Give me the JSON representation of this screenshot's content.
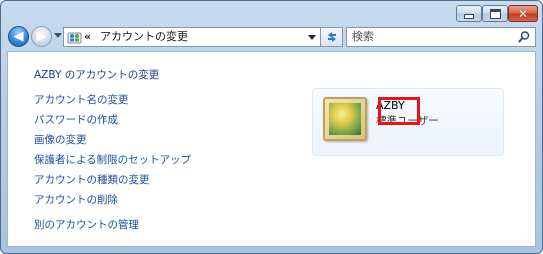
{
  "titlebar": {
    "minimize_icon": "minimize-icon",
    "maximize_icon": "maximize-icon",
    "close_icon": "close-icon",
    "close_glyph": "✕"
  },
  "navigation": {
    "back_icon": "back-arrow-icon",
    "forward_icon": "forward-arrow-icon",
    "back_glyph": "◀",
    "forward_glyph": "▶"
  },
  "address": {
    "chevron": "«",
    "path": "アカウントの変更"
  },
  "search": {
    "placeholder": "検索"
  },
  "tasks": {
    "title": "AZBY のアカウントの変更",
    "items": [
      "アカウント名の変更",
      "パスワードの作成",
      "画像の変更",
      "保護者による制限のセットアップ",
      "アカウントの種類の変更",
      "アカウントの削除"
    ],
    "manage_other": "別のアカウントの管理"
  },
  "account": {
    "name": "AZBY",
    "type": "標準ユーザー"
  },
  "colors": {
    "link": "#1e4fa3",
    "highlight": "#e8141a",
    "window_frame": "#b7cfe6"
  }
}
